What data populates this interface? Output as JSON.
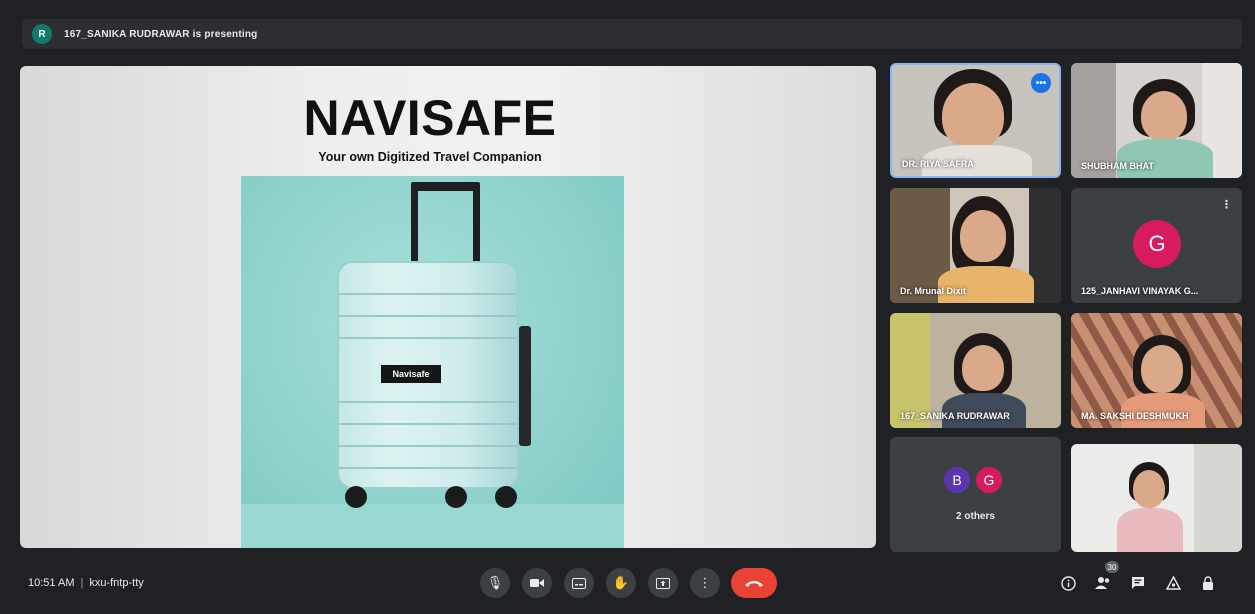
{
  "banner": {
    "avatar_letter": "R",
    "text": "167_SANIKA RUDRAWAR is presenting"
  },
  "slide": {
    "title": "NAVISAFE",
    "subtitle": "Your own Digitized Travel Companion",
    "luggage_tag": "Navisafe"
  },
  "participants": [
    {
      "name": "DR. RIYA SAFRA",
      "speaking": true
    },
    {
      "name": "SHUBHAM BHAT"
    },
    {
      "name": "Dr. Mrunal Dixit"
    },
    {
      "name": "125_JANHAVI VINAYAK G...",
      "avatar_letter": "G",
      "avatar_color": "#d81b60"
    },
    {
      "name": "167_SANIKA RUDRAWAR"
    },
    {
      "name": "MA. SAKSHI DESHMUKH"
    },
    {
      "others_label": "2 others",
      "avatars": [
        {
          "letter": "B",
          "color": "#5e35b1"
        },
        {
          "letter": "G",
          "color": "#d81b60"
        }
      ]
    },
    {
      "name": ""
    }
  ],
  "bottom": {
    "time": "10:51 AM",
    "meeting_code": "kxu-fntp-tty",
    "participant_count": "30"
  },
  "colors": {
    "end_call": "#ea4335",
    "control_bg": "#3c4043",
    "background": "#202124"
  }
}
